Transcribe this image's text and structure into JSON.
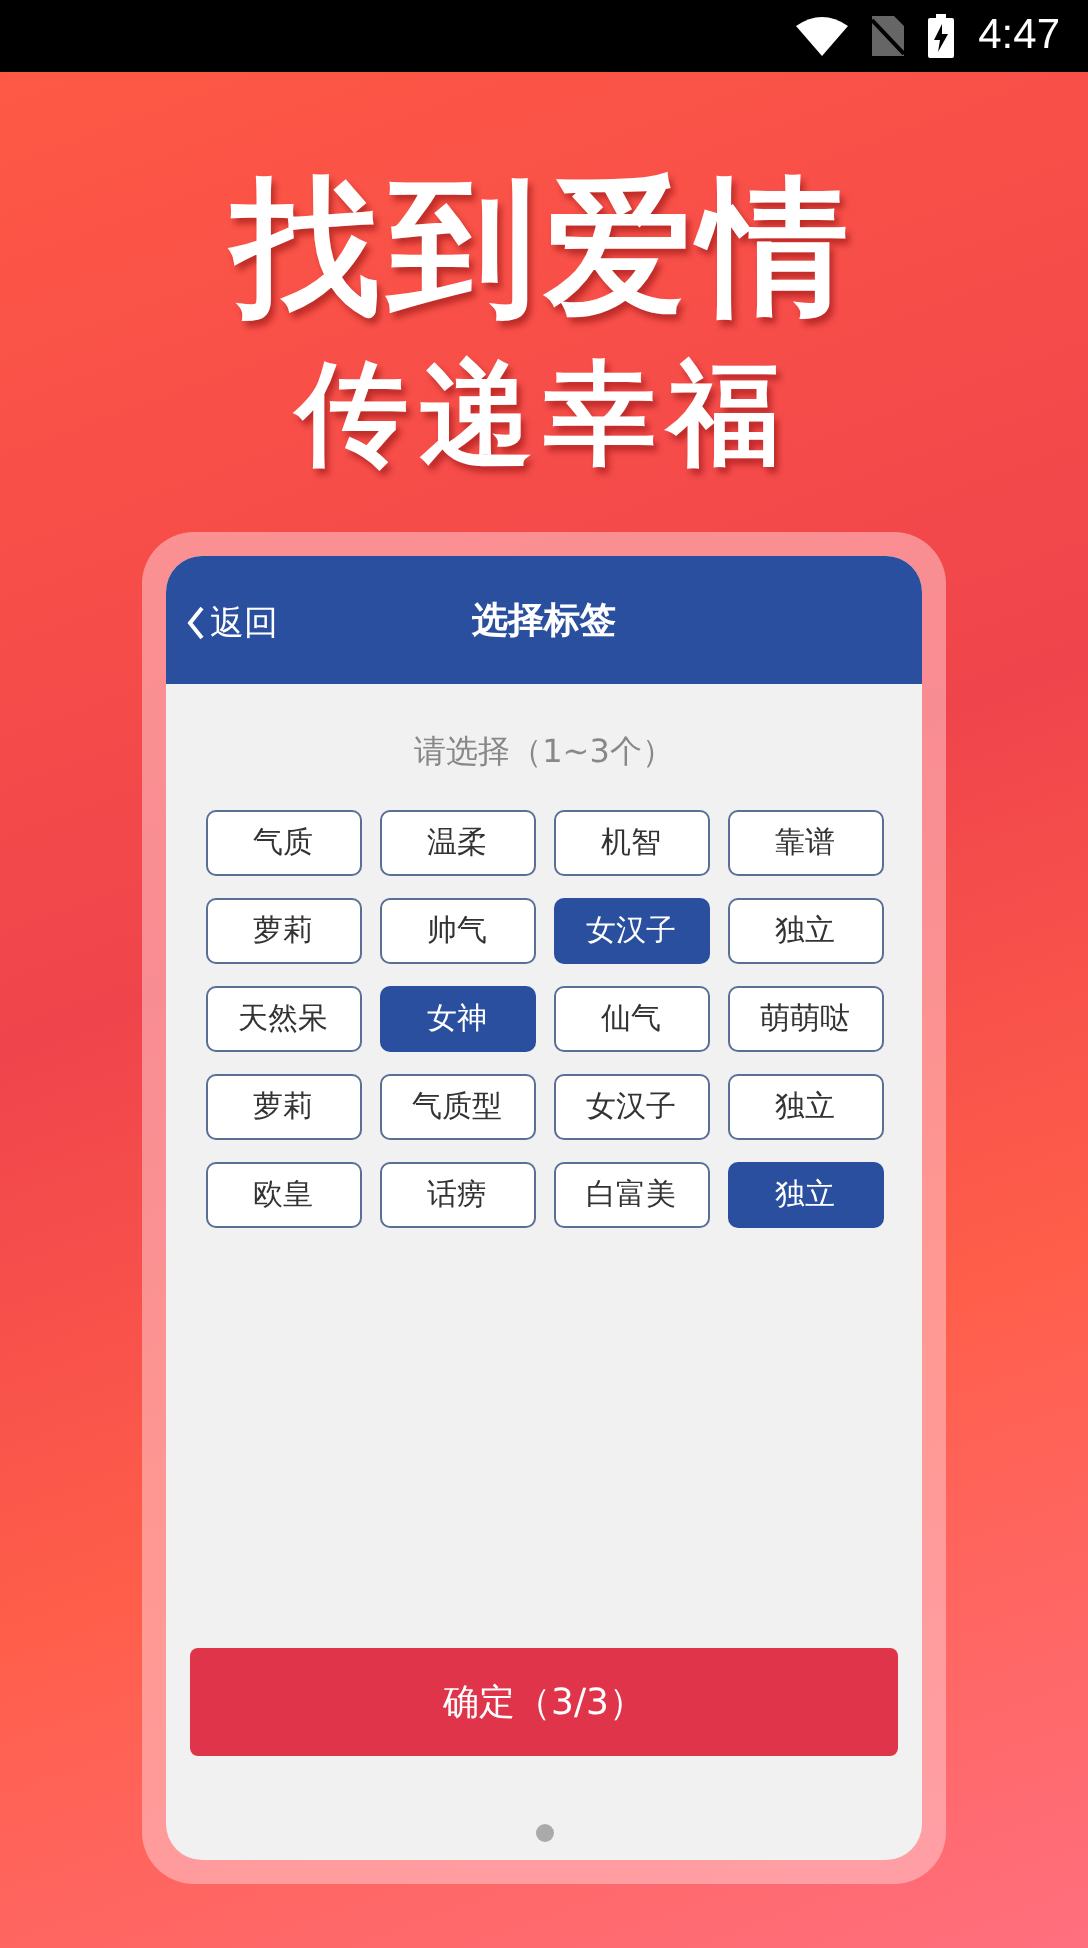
{
  "status_bar": {
    "time": "4:47"
  },
  "headline": {
    "title": "找到爱情",
    "subtitle": "传递幸福"
  },
  "screen": {
    "header": {
      "back": "返回",
      "title": "选择标签"
    },
    "hint": "请选择（1~3个）",
    "tags": [
      {
        "label": "气质",
        "selected": false
      },
      {
        "label": "温柔",
        "selected": false
      },
      {
        "label": "机智",
        "selected": false
      },
      {
        "label": "靠谱",
        "selected": false
      },
      {
        "label": "萝莉",
        "selected": false
      },
      {
        "label": "帅气",
        "selected": false
      },
      {
        "label": "女汉子",
        "selected": true
      },
      {
        "label": "独立",
        "selected": false
      },
      {
        "label": "天然呆",
        "selected": false
      },
      {
        "label": "女神",
        "selected": true
      },
      {
        "label": "仙气",
        "selected": false
      },
      {
        "label": "萌萌哒",
        "selected": false
      },
      {
        "label": "萝莉",
        "selected": false
      },
      {
        "label": "气质型",
        "selected": false
      },
      {
        "label": "女汉子",
        "selected": false
      },
      {
        "label": "独立",
        "selected": false
      },
      {
        "label": "欧皇",
        "selected": false
      },
      {
        "label": "话痨",
        "selected": false
      },
      {
        "label": "白富美",
        "selected": false
      },
      {
        "label": "独立",
        "selected": true
      }
    ],
    "confirm": "确定（3/3）"
  }
}
